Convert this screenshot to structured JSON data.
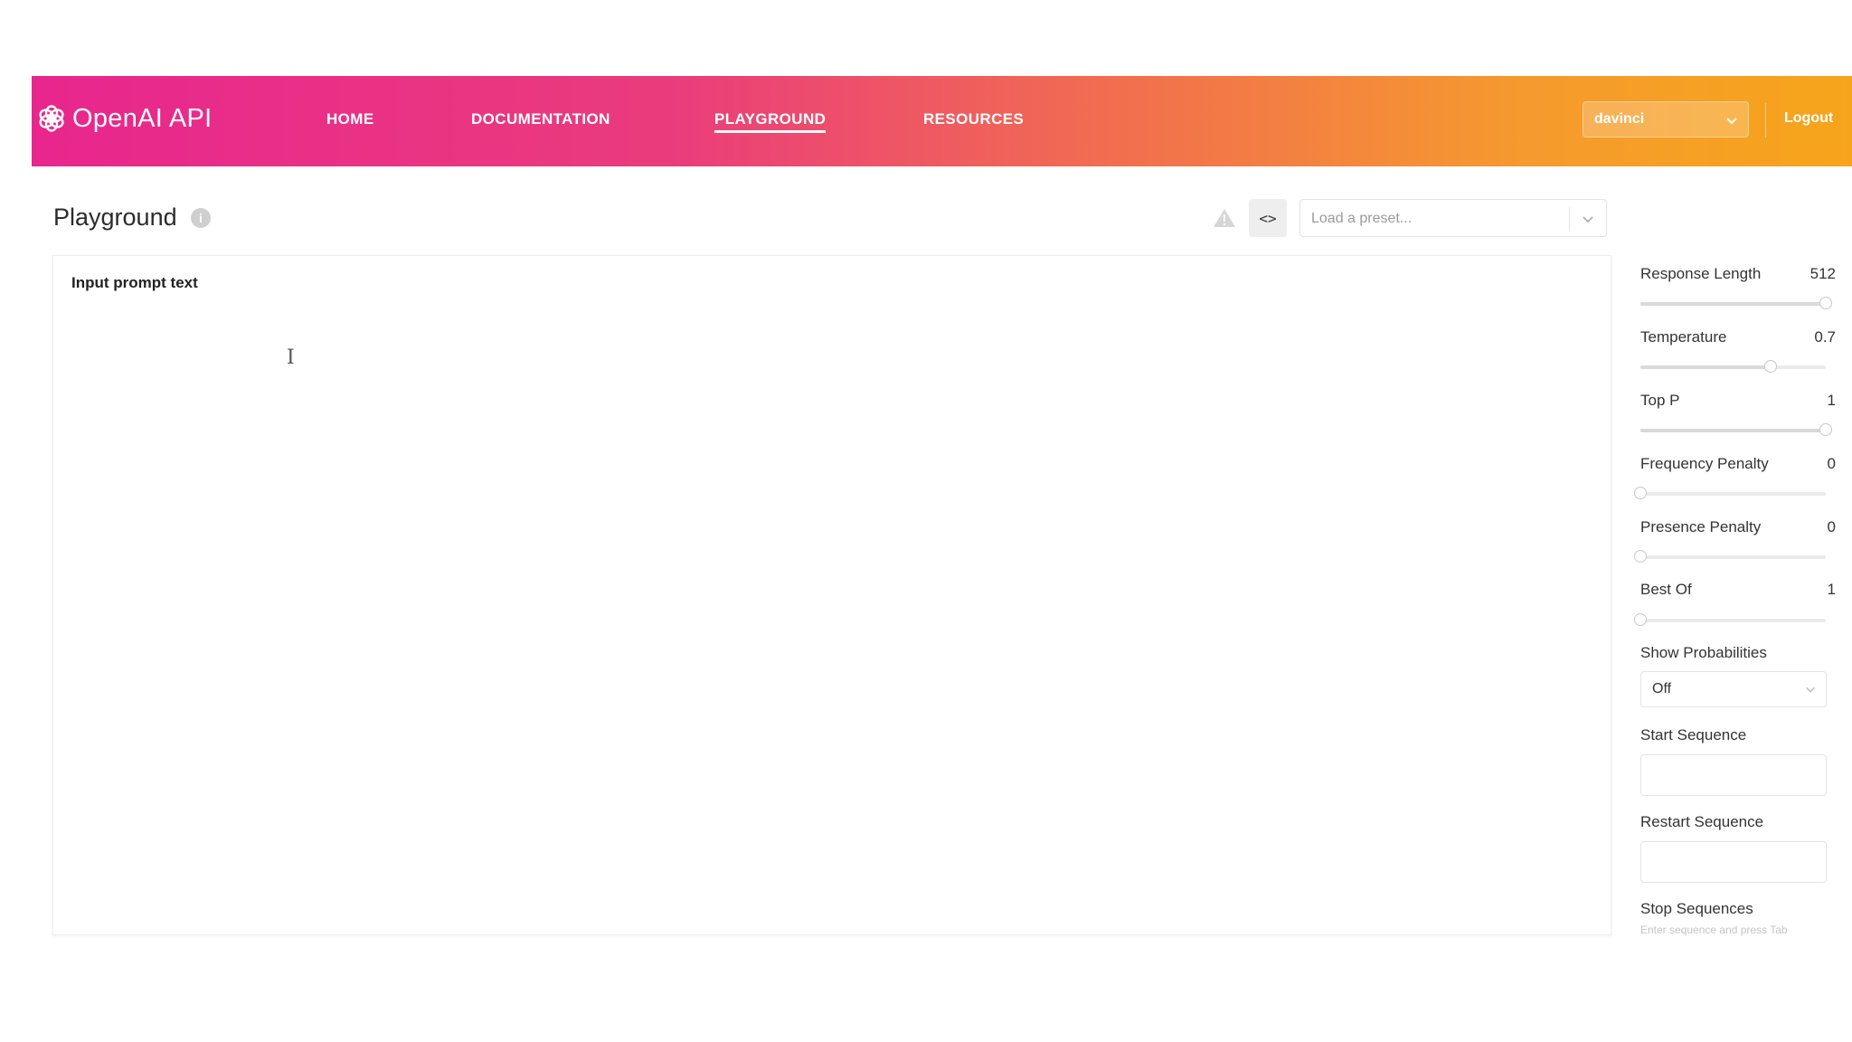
{
  "header": {
    "brand": "OpenAI API",
    "nav": [
      {
        "label": "HOME",
        "active": false
      },
      {
        "label": "DOCUMENTATION",
        "active": false
      },
      {
        "label": "PLAYGROUND",
        "active": true
      },
      {
        "label": "RESOURCES",
        "active": false
      }
    ],
    "engine": "davinci",
    "logout": "Logout",
    "gradient": [
      "#e8268e",
      "#f6a51b"
    ]
  },
  "toolbar": {
    "title": "Playground",
    "info_icon": "info-icon",
    "warning_icon": "warning-icon",
    "code_icon": "code-icon",
    "preset_placeholder": "Load a preset..."
  },
  "editor": {
    "prompt": "Input prompt text"
  },
  "settings": {
    "response_length": {
      "label": "Response Length",
      "value": "512",
      "fraction": 1.0
    },
    "temperature": {
      "label": "Temperature",
      "value": "0.7",
      "fraction": 0.7
    },
    "top_p": {
      "label": "Top P",
      "value": "1",
      "fraction": 1.0
    },
    "frequency_penalty": {
      "label": "Frequency Penalty",
      "value": "0",
      "fraction": 0.0
    },
    "presence_penalty": {
      "label": "Presence Penalty",
      "value": "0",
      "fraction": 0.0
    },
    "best_of": {
      "label": "Best Of",
      "value": "1",
      "fraction": 0.0
    },
    "show_probabilities": {
      "label": "Show Probabilities",
      "value": "Off"
    },
    "start_sequence": {
      "label": "Start Sequence",
      "value": ""
    },
    "restart_sequence": {
      "label": "Restart Sequence",
      "value": ""
    },
    "stop_sequences": {
      "label": "Stop Sequences",
      "hint": "Enter sequence and press Tab"
    }
  }
}
